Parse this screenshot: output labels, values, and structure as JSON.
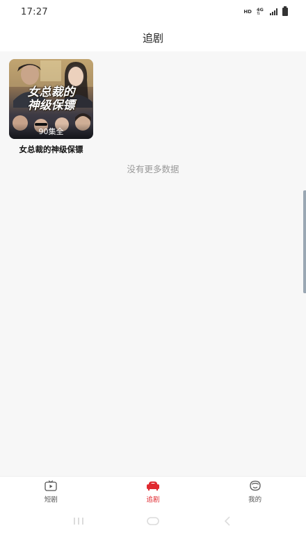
{
  "status_bar": {
    "time": "17:27",
    "hd": "HD",
    "network": "4G"
  },
  "header": {
    "title": "追剧"
  },
  "dramas": [
    {
      "poster_title_line1": "女总裁的",
      "poster_title_line2": "神级保镖",
      "episodes": "90集全",
      "title": "女总裁的神级保镖"
    }
  ],
  "no_more_text": "没有更多数据",
  "tabbar": {
    "items": [
      {
        "label": "短剧",
        "icon": "tv-icon",
        "active": false
      },
      {
        "label": "追剧",
        "icon": "sofa-icon",
        "active": true
      },
      {
        "label": "我的",
        "icon": "face-icon",
        "active": false
      }
    ]
  },
  "colors": {
    "accent": "#e0292f",
    "background": "#f7f7f7",
    "muted_text": "#999999"
  }
}
